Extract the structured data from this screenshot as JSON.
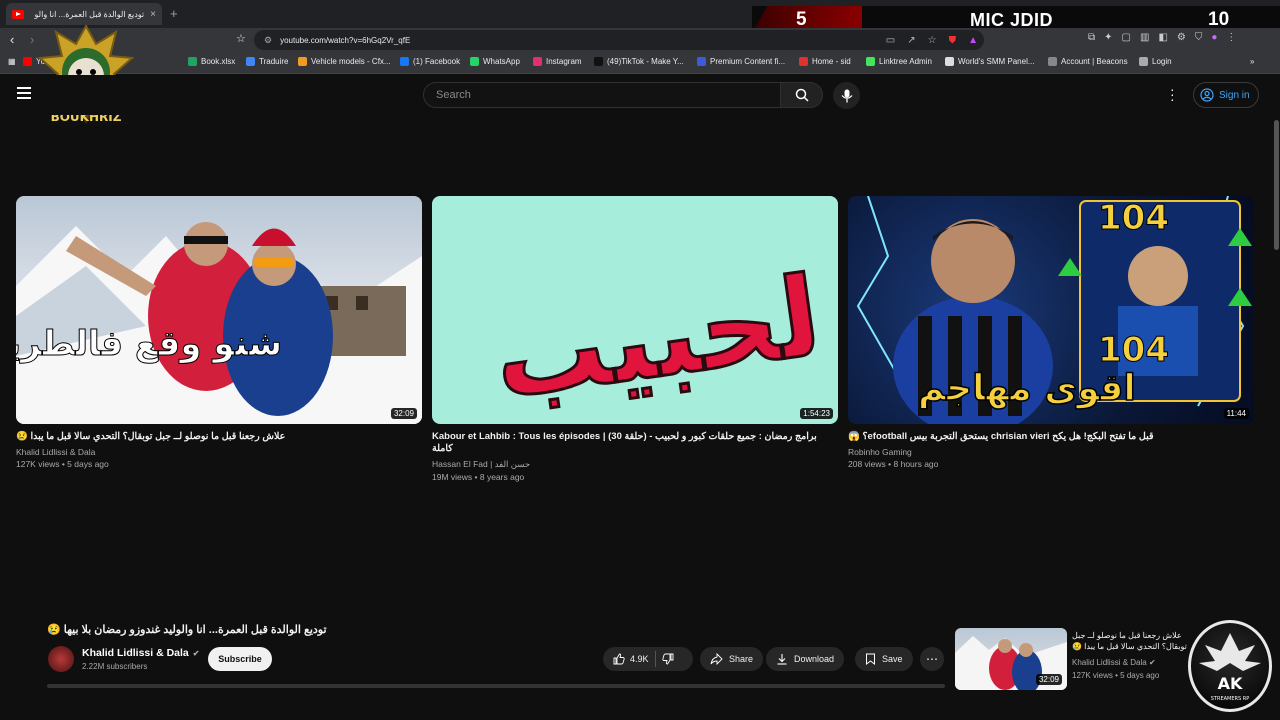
{
  "browser": {
    "tab_title": "توديع الوالدة قبل العمرة... انا والو",
    "tab_close": "×",
    "new_tab": "+",
    "url": "youtube.com/watch?v=6hGq2Vr_qfE",
    "bookmarks": [
      {
        "label": "YouTube",
        "color": "#ff0000"
      },
      {
        "label": "Book.xlsx",
        "color": "#21a366"
      },
      {
        "label": "Traduire",
        "color": "#4285f4"
      },
      {
        "label": "Vehicle models - Cfx...",
        "color": "#f29b24"
      },
      {
        "label": "(1) Facebook",
        "color": "#1877f2"
      },
      {
        "label": "WhatsApp",
        "color": "#25d366"
      },
      {
        "label": "Instagram",
        "color": "#e1306c"
      },
      {
        "label": "(49)TikTok - Make Y...",
        "color": "#111111"
      },
      {
        "label": "Premium Content fi...",
        "color": "#3b5bdb"
      },
      {
        "label": "Home - sid",
        "color": "#e03131"
      },
      {
        "label": "Linktree Admin",
        "color": "#43e55e"
      },
      {
        "label": "World's SMM Panel...",
        "color": "#dddddd"
      },
      {
        "label": "Account | Beacons",
        "color": "#888888"
      },
      {
        "label": "Login",
        "color": "#aaaaaa"
      }
    ]
  },
  "overlay": {
    "score_left": "5",
    "score_name": "MIC JDID",
    "score_right": "10",
    "channel_logo_text": "AIT BOUKHRIZ",
    "ak_logo_text": "AK",
    "ak_logo_sub": "STREAMERS RP"
  },
  "header": {
    "search_placeholder": "Search",
    "signin_label": "Sign in"
  },
  "videos": [
    {
      "title": "علاش رجعنا قبل ما نوصلو لــ جبل توبقال؟ التحدي سالا قبل ما يبدا 😢",
      "channel": "Khalid Lidlissi & Dala",
      "stats": "127K views • 5 days ago",
      "duration": "32:09",
      "thumb_text": "شنو وقع فالطريق"
    },
    {
      "title": "Kabour et Lahbib : Tous les épisodes | (30 حلقة) - برامج رمضان : جميع حلقات كبور و لحبيب كاملة",
      "channel": "Hassan El Fad | حسن الفد",
      "stats": "19M views • 8 years ago",
      "duration": "1:54:23",
      "thumb_text": "كبور و لحبيب"
    },
    {
      "title": "قبل ما تفتح البكج! هل يكح chrisian vieri يستحق التجربة بيس efootball؟ 😱",
      "channel": "Robinho Gaming",
      "stats": "208 views • 8 hours ago",
      "duration": "11:44",
      "thumb_text": "اقوى مهاجم",
      "thumb_num": "104"
    }
  ],
  "watch": {
    "title": "توديع الوالدة قبل العمرة... انا والوليد غندوزو رمضان بلا بيها 😢",
    "channel": "Khalid Lidlissi & Dala",
    "subscribers": "2.22M subscribers",
    "subscribe_label": "Subscribe",
    "likes": "4.9K",
    "share_label": "Share",
    "download_label": "Download",
    "save_label": "Save"
  },
  "side_video": {
    "title": "علاش رجعنا قبل ما نوصلو لــ جبل توبقال؟ التحدي سالا قبل ما يبدا 😢",
    "channel": "Khalid Lidlissi & Dala",
    "stats": "127K views • 5 days ago",
    "duration": "32:09"
  }
}
